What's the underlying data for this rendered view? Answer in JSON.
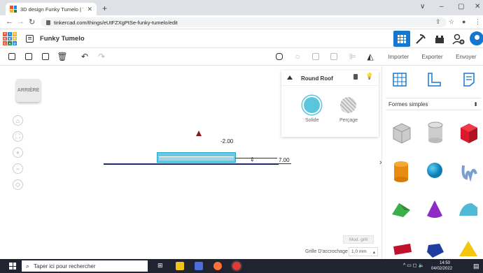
{
  "browser": {
    "tab_title": "3D design Funky Tumelo | Tinker",
    "tab_close": "✕",
    "new_tab": "+",
    "url": "tinkercad.com/things/eUtFZXgPtSe-funky-tumelo/edit",
    "window_controls": [
      "∨",
      "–",
      "▢",
      "✕"
    ]
  },
  "app": {
    "logo_letters": [
      "T",
      "I",
      "N",
      "K",
      "E",
      "R",
      "C",
      "A",
      "D"
    ],
    "logo_colors": [
      "#e8543a",
      "#1e88e5",
      "#f6b21a",
      "#e8543a",
      "#1e88e5",
      "#f6b21a",
      "#e8543a",
      "#2e7d32",
      "#1e88e5"
    ],
    "design_title": "Funky Tumelo",
    "accent": "#1477d2"
  },
  "toolbar": {
    "right_buttons": [
      "Importer",
      "Exporter",
      "Envoyer"
    ]
  },
  "workspace": {
    "viewcube_label": "ARRIÈRE",
    "dim_height": "-2.00",
    "dim_width": "7.00",
    "mod_grid": "Mod. grill",
    "snap_label": "Grille D'accrochage",
    "snap_value": "1,0 mm"
  },
  "shape_panel": {
    "title": "Round Roof",
    "solid_label": "Solide",
    "hole_label": "Perçage"
  },
  "library": {
    "category": "Formes simples"
  },
  "taskbar": {
    "search_placeholder": "Taper ici pour rechercher",
    "time": "14:50",
    "date": "04/02/2022"
  }
}
